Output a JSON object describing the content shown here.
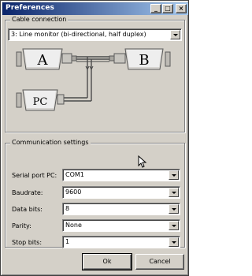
{
  "window": {
    "title": "Preferences",
    "controls": {
      "minimize": "_",
      "maximize": "□",
      "close": "×"
    }
  },
  "cable": {
    "group_label": "Cable connection",
    "selected": "3: Line monitor (bi-directional, half duplex)",
    "diagram": {
      "device_a": "A",
      "device_b": "B",
      "pc": "PC"
    }
  },
  "comm": {
    "group_label": "Communication settings",
    "fields": [
      {
        "label": "Serial port PC:",
        "value": "COM1"
      },
      {
        "label": "Baudrate:",
        "value": "9600"
      },
      {
        "label": "Data bits:",
        "value": "8"
      },
      {
        "label": "Parity:",
        "value": "None"
      },
      {
        "label": "Stop bits:",
        "value": "1"
      }
    ]
  },
  "buttons": {
    "ok": "Ok",
    "cancel": "Cancel"
  }
}
